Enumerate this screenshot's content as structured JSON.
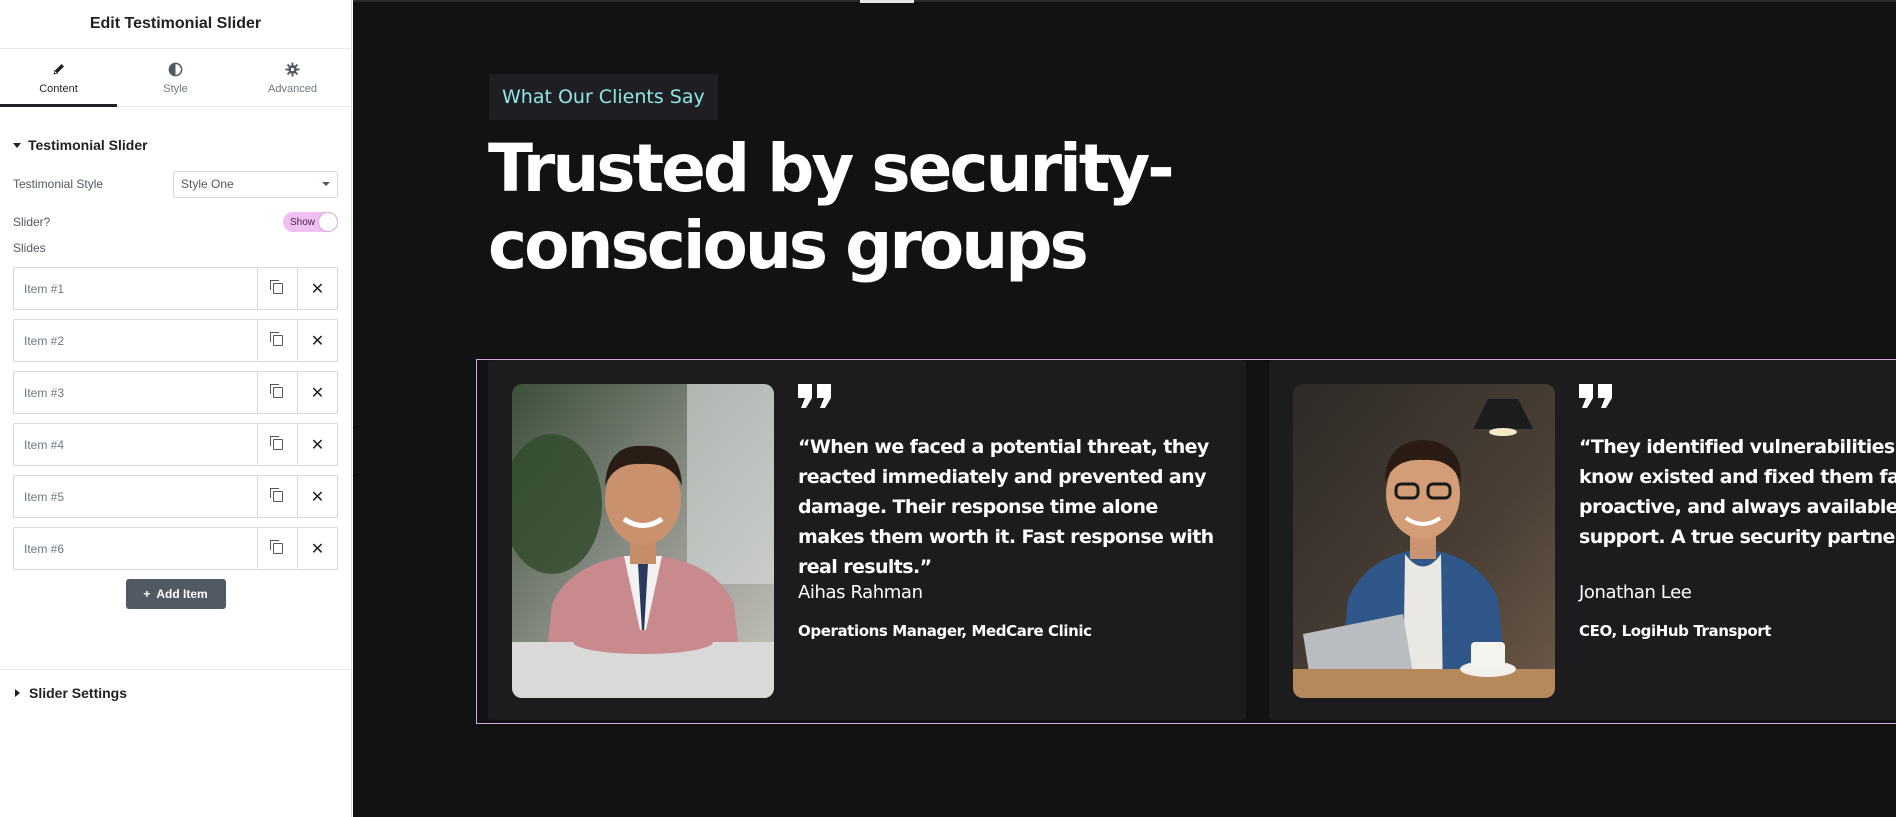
{
  "panel": {
    "title": "Edit Testimonial Slider",
    "tabs": [
      {
        "label": "Content",
        "icon": "pencil-icon",
        "active": true
      },
      {
        "label": "Style",
        "icon": "contrast-icon",
        "active": false
      },
      {
        "label": "Advanced",
        "icon": "gear-icon",
        "active": false
      }
    ],
    "section_title": "Testimonial Slider",
    "style_label": "Testimonial Style",
    "style_value": "Style One",
    "slider_label": "Slider?",
    "slider_toggle": "Show",
    "slides_label": "Slides",
    "items": [
      "Item #1",
      "Item #2",
      "Item #3",
      "Item #4",
      "Item #5",
      "Item #6"
    ],
    "add_item": "Add Item",
    "section2_title": "Slider Settings",
    "accent": "#f0c0f2"
  },
  "preview": {
    "kicker": "What Our Clients Say",
    "headline_line1": "Trusted by security-",
    "headline_line2": "conscious groups",
    "slides": [
      {
        "quote": "“When we faced a potential threat, they reacted immediately and prevented any damage. Their response time alone makes them worth it. Fast response with real results.”",
        "name": "Aihas Rahman",
        "role": "Operations Manager, MedCare Clinic"
      },
      {
        "quote": "“They identified vulnerabilities we didn’t know existed and fixed them fast. Pro proactive, and always available when support. A true security partner.”",
        "name": "Jonathan Lee",
        "role": "CEO, LogiHub Transport"
      }
    ],
    "accent_cyan": "#8fe6e6",
    "slider_border": "#d9a5db"
  }
}
